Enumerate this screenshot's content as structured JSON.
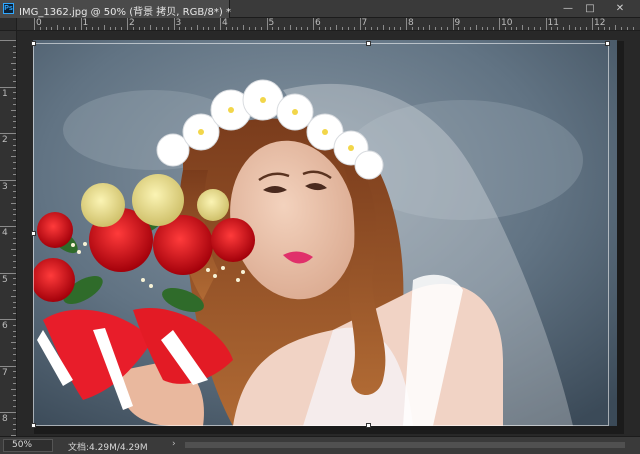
{
  "window": {
    "title": "IMG_1362.jpg @ 50% (背景 拷贝, RGB/8*) *",
    "app_icon": "Ps",
    "minimize": "—",
    "restore": "□",
    "close": "✕"
  },
  "rulers": {
    "horizontal_labels": [
      "0",
      "1",
      "2",
      "3",
      "4",
      "5",
      "6",
      "7",
      "8",
      "9",
      "10",
      "11",
      "12"
    ],
    "vertical_labels": [
      "1",
      "2",
      "3",
      "4",
      "5",
      "6",
      "7",
      "8"
    ]
  },
  "canvas": {
    "description_icons": [
      "move-handle-icon"
    ],
    "background_color": "#5d6f80"
  },
  "status": {
    "zoom": "50%",
    "doc_info": "文档:4.29M/4.29M",
    "arrow": "›"
  }
}
